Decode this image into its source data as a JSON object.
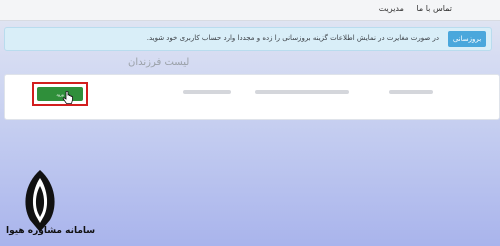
{
  "header": {
    "links": [
      {
        "label": "تماس با ما"
      },
      {
        "label": "مدیریت"
      }
    ]
  },
  "alert": {
    "button_label": "بروزسانی",
    "message": "در صورت مغایرت در نمایش اطلاعات گزینه بروزسانی را زده و مجددا وارد حساب کاربری خود شوید."
  },
  "children_list": {
    "title": "لیست فرزندان",
    "enter_button_label": "ورود"
  },
  "watermark": {
    "text": "سامانه مشاوره هیوا"
  }
}
